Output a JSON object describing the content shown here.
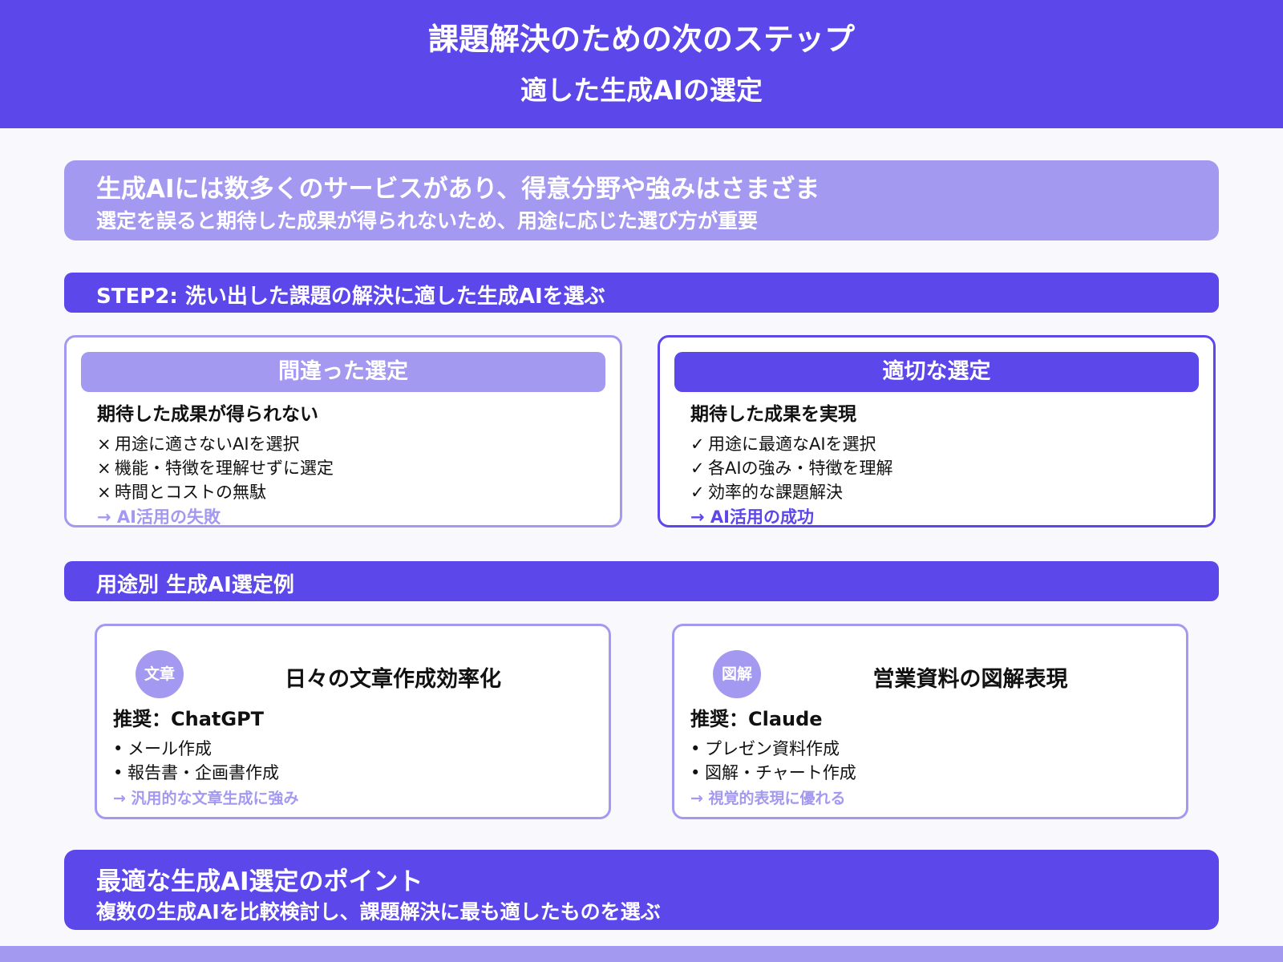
{
  "header": {
    "title": "課題解決のための次のステップ",
    "subtitle": "適した生成AIの選定"
  },
  "intro": {
    "line1": "生成AIには数多くのサービスがあり、得意分野や強みはさまざま",
    "line2": "選定を誤ると期待した成果が得られないため、用途に応じた選び方が重要"
  },
  "step2_bar": "STEP2: 洗い出した課題の解決に適した生成AIを選ぶ",
  "wrong": {
    "label": "間違った選定",
    "heading": "期待した成果が得られない",
    "mark": "×",
    "items": [
      "用途に適さないAIを選択",
      "機能・特徴を理解せずに選定",
      "時間とコストの無駄"
    ],
    "result": "→ AI活用の失敗"
  },
  "right": {
    "label": "適切な選定",
    "heading": "期待した成果を実現",
    "mark": "✓",
    "items": [
      "用途に最適なAIを選択",
      "各AIの強み・特徴を理解",
      "効率的な課題解決"
    ],
    "result": "→ AI活用の成功"
  },
  "usecase_bar": "用途別 生成AI選定例",
  "usecases": [
    {
      "badge": "文章",
      "title": "日々の文章作成効率化",
      "recommend": "推奨：ChatGPT",
      "items": [
        "メール作成",
        "報告書・企画書作成"
      ],
      "note": "→ 汎用的な文章生成に強み"
    },
    {
      "badge": "図解",
      "title": "営業資料の図解表現",
      "recommend": "推奨：Claude",
      "items": [
        "プレゼン資料作成",
        "図解・チャート作成"
      ],
      "note": "→ 視覚的表現に優れる"
    }
  ],
  "bullet": "•",
  "point": {
    "line1": "最適な生成AI選定のポイント",
    "line2": "複数の生成AIを比較検討し、課題解決に最も適したものを選ぶ"
  },
  "colors": {
    "primary": "#5c47eb",
    "light": "#a399f0",
    "background": "#f8f8fd"
  }
}
